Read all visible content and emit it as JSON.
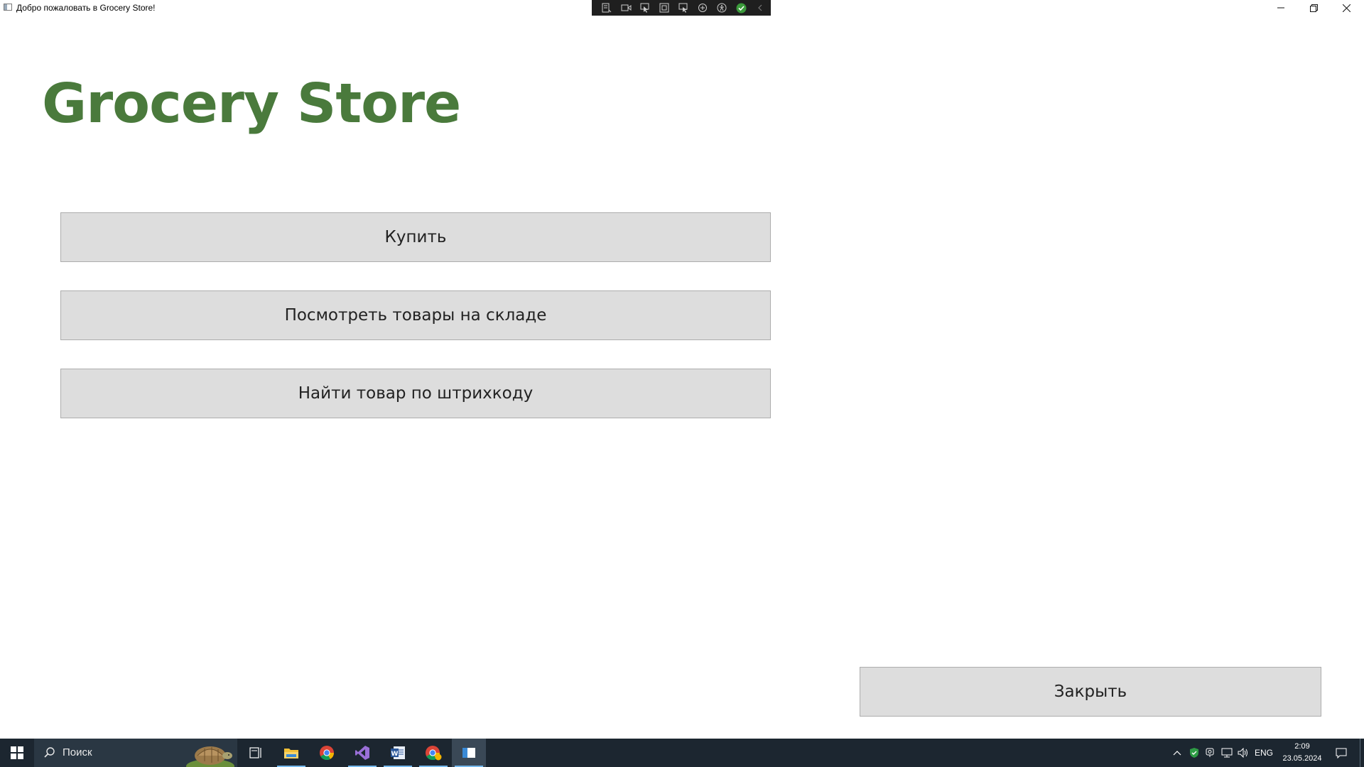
{
  "window": {
    "title": "Добро пожаловать в Grocery Store!",
    "minimize_glyph": "—",
    "restore_glyph": "❐",
    "close_glyph": "✕"
  },
  "debug_toolbar": {
    "icons": [
      "live-visual-tree-icon",
      "record-icon",
      "select-element-icon",
      "display-layout-adorners-icon",
      "track-focus-icon",
      "binding-failures-icon",
      "accessibility-icon",
      "hot-reload-check-icon",
      "collapse-toolbar-icon"
    ]
  },
  "main": {
    "heading": "Grocery Store",
    "buttons": {
      "buy": "Купить",
      "view_stock": "Посмотреть товары на складе",
      "find_barcode": "Найти товар по штрихкоду",
      "close": "Закрыть"
    }
  },
  "colors": {
    "heading": "#4a7a3c",
    "button_bg": "#dddddd",
    "button_border": "#adadad",
    "taskbar_bg": "#1c2630"
  },
  "taskbar": {
    "search_placeholder": "Поиск",
    "apps": [
      "file-explorer-icon",
      "chrome-icon",
      "visual-studio-icon",
      "word-icon",
      "chrome-profile-icon",
      "running-app-window-icon"
    ],
    "tray": {
      "language": "ENG",
      "time": "2:09",
      "date": "23.05.2024"
    }
  }
}
